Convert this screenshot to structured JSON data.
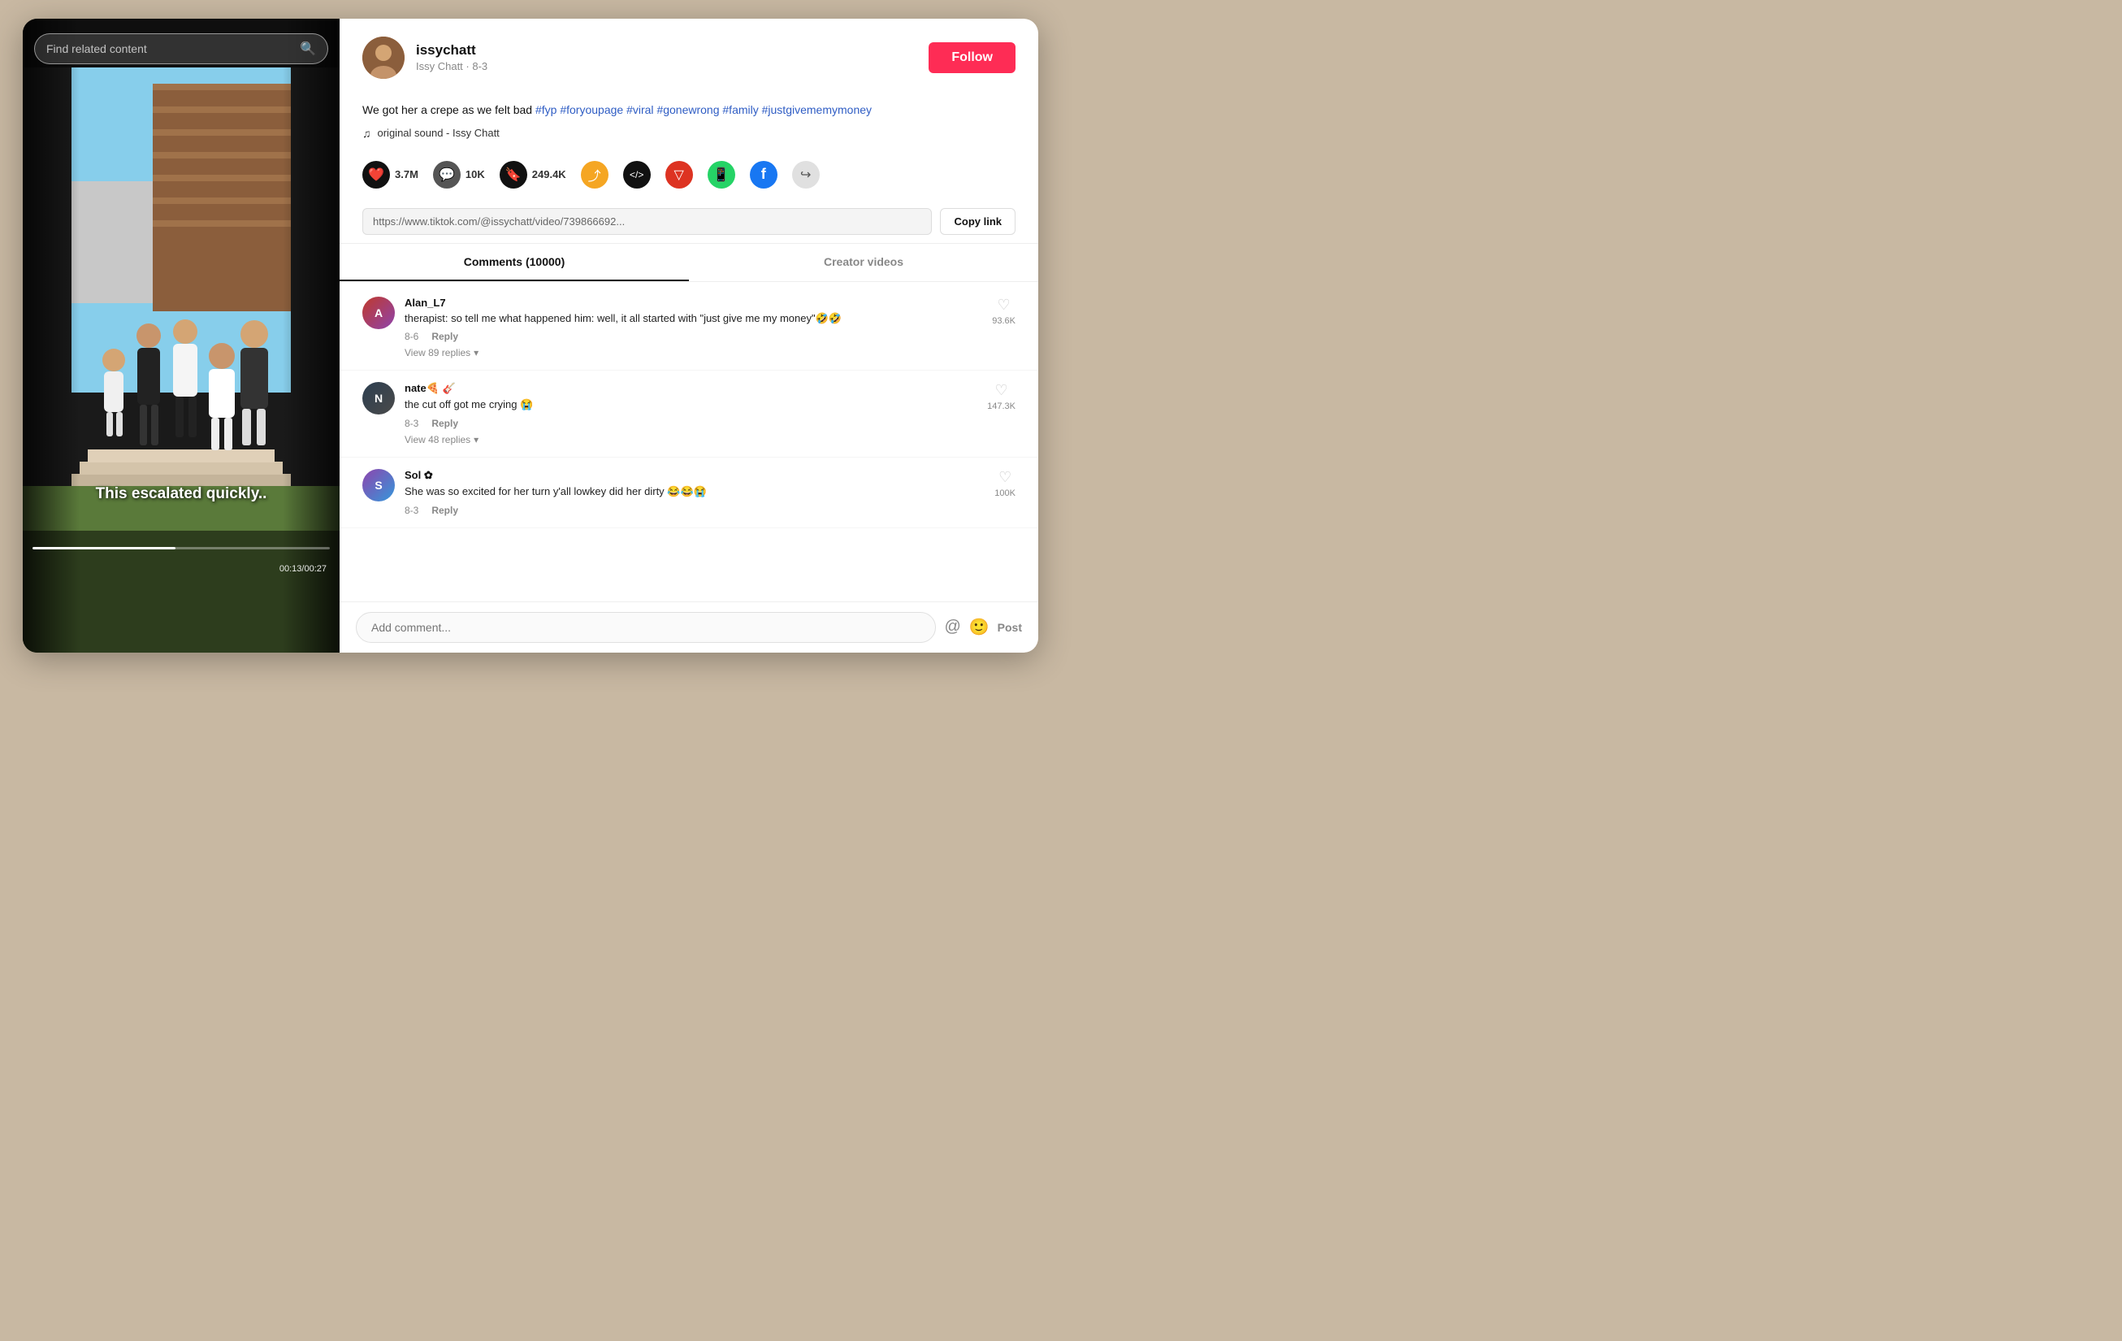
{
  "search": {
    "placeholder": "Find related content"
  },
  "user": {
    "username": "issychatt",
    "display_name": "Issy Chatt",
    "date": "8-3",
    "follow_label": "Follow"
  },
  "description": {
    "text": "We got her a crepe as we felt bad ",
    "hashtags": [
      "#fyp",
      "#foryoupage",
      "#viral",
      "#gonewrong",
      "#family",
      "#justgivememymoney"
    ],
    "sound": "original sound - Issy Chatt"
  },
  "stats": {
    "likes": "3.7M",
    "comments": "10K",
    "bookmarks": "249.4K"
  },
  "url": {
    "value": "https://www.tiktok.com/@issychatt/video/739866692...",
    "copy_label": "Copy link"
  },
  "tabs": {
    "comments_label": "Comments (10000)",
    "creator_label": "Creator videos"
  },
  "video": {
    "subtitle": "This escalated quickly..",
    "time": "00:13/00:27",
    "progress": 48
  },
  "comments": [
    {
      "username": "Alan_L7",
      "date": "8-6",
      "text": "therapist: so tell me what happened him: well, it all started with \"just give me my money\"🤣🤣",
      "likes": "93.6K",
      "replies": "View 89 replies"
    },
    {
      "username": "nate🍕 🎸",
      "date": "8-3",
      "text": "the cut off got me crying 😭",
      "likes": "147.3K",
      "replies": "View 48 replies"
    },
    {
      "username": "Sol ✿",
      "date": "8-3",
      "text": "She was so excited for her turn y'all lowkey did her dirty 😂😂😭",
      "likes": "100K",
      "replies": null
    }
  ],
  "add_comment": {
    "placeholder": "Add comment...",
    "post_label": "Post"
  },
  "colors": {
    "follow_btn": "#FE2C55",
    "hashtag": "#2F5DC4",
    "active_tab_border": "#111111"
  }
}
